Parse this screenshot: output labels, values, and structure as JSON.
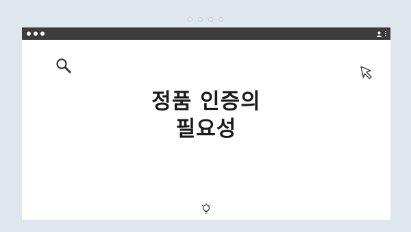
{
  "title": {
    "line1": "정품 인증의",
    "line2": "필요성"
  },
  "icons": {
    "window_controls": "traffic-light-dots",
    "account": "user-icon",
    "menu": "kebab-menu-icon",
    "search": "search-icon",
    "cursor": "cursor-icon",
    "bottom": "lightbulb-icon"
  },
  "colors": {
    "background": "#dfe6ee",
    "titlebar": "#3c3c3c",
    "window": "#ffffff",
    "text": "#1a1a1a"
  }
}
